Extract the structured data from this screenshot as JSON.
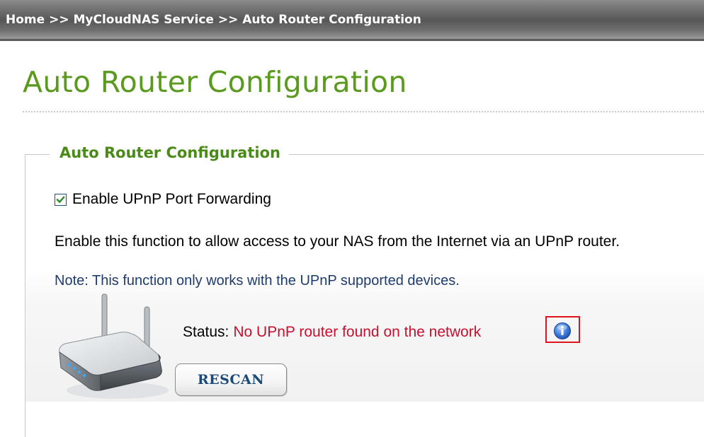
{
  "breadcrumb": "Home >> MyCloudNAS Service >> Auto Router Configuration",
  "page_title": "Auto Router Configuration",
  "section": {
    "legend": "Auto Router Configuration",
    "upnp_checkbox": {
      "label": "Enable UPnP Port Forwarding",
      "checked": true
    },
    "description": "Enable this function to allow access to your NAS from the Internet via an UPnP router.",
    "note": "Note: This function only works with the UPnP supported devices.",
    "status": {
      "label": "Status:",
      "value": "No UPnP router found on the network"
    },
    "rescan_label": "RESCAN"
  },
  "icons": {
    "router": "router-icon",
    "info": "info-icon",
    "check": "checkmark-icon"
  },
  "colors": {
    "title_green": "#5a9a1e",
    "status_red": "#c8102e",
    "note_blue": "#1f3c6e",
    "highlight_red": "#e0141c",
    "info_blue": "#3b78d8"
  }
}
